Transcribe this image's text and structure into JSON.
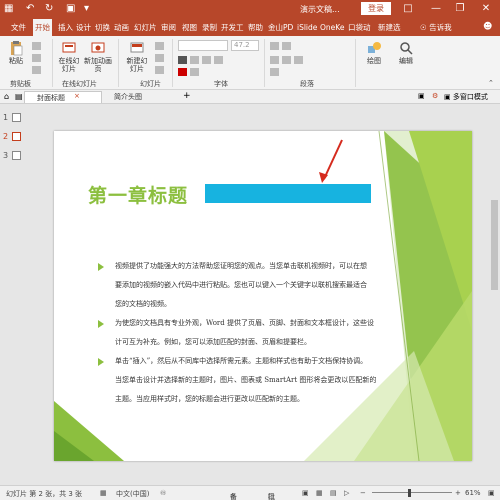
{
  "titlebar": {
    "save_icon": "save-icon",
    "undo_icon": "undo-icon",
    "redo_icon": "redo-icon",
    "doc_title": "演示文稿...",
    "login_label": "登录",
    "bg_color": "#b7472a"
  },
  "tabs": [
    {
      "label": "文件"
    },
    {
      "label": "开始"
    },
    {
      "label": "插入"
    },
    {
      "label": "设计"
    },
    {
      "label": "切换"
    },
    {
      "label": "动画"
    },
    {
      "label": "幻灯片"
    },
    {
      "label": "审阅"
    },
    {
      "label": "视图"
    },
    {
      "label": "录制"
    },
    {
      "label": "开发工"
    },
    {
      "label": "帮助"
    },
    {
      "label": "金山PD"
    },
    {
      "label": "iSlide"
    },
    {
      "label": "OneKe"
    },
    {
      "label": "口袋动"
    },
    {
      "label": "新建选"
    }
  ],
  "tell_me": "告诉我",
  "ribbon": {
    "paste_label": "粘贴",
    "clipboard_group": "剪贴板",
    "online_slide_label": "在线幻灯片",
    "new_anim_label": "新加动画页",
    "online_slide_group": "在线幻灯片",
    "new_slide_label": "新建幻灯片",
    "slides_group": "幻灯片",
    "font_size": "47.2",
    "font_group": "字体",
    "paragraph_group": "段落",
    "drawing_label": "绘图",
    "edit_label": "编辑"
  },
  "doctabs": {
    "tab1": "封面标题",
    "tab2": "简介头图",
    "view_mode": "多窗口模式"
  },
  "thumbnails": [
    {
      "num": "1"
    },
    {
      "num": "2"
    },
    {
      "num": "3"
    }
  ],
  "slide": {
    "title": "第一章标题",
    "accent_green": "#8cbf3f",
    "accent_blue": "#17b3e0",
    "bullets": [
      {
        "lines": [
          "视频提供了功能强大的方法帮助您证明您的观点。当您单击联机视频时，可以在想",
          "要添加的视频的嵌入代码中进行粘贴。您也可以键入一个关键字以联机搜索最适合",
          "您的文档的视频。"
        ]
      },
      {
        "lines": [
          "为使您的文档具有专业外观，Word 提供了页眉、页脚、封面和文本框设计，这些设",
          "计可互为补充。例如，您可以添加匹配的封面、页眉和提要栏。"
        ]
      },
      {
        "lines": [
          "单击“插入”，然后从不同库中选择所需元素。主题和样式也有助于文档保持协调。",
          "当您单击设计并选择新的主题时，图片、图表或 SmartArt 图形将会更改以匹配新的",
          "主题。当应用样式时，您的标题会进行更改以匹配新的主题。"
        ]
      }
    ]
  },
  "status": {
    "slide_info": "幻灯片 第 2 张，共 3 张",
    "language": "中文(中国)",
    "notes": "备注",
    "comments": "批注",
    "zoom": "61%"
  }
}
